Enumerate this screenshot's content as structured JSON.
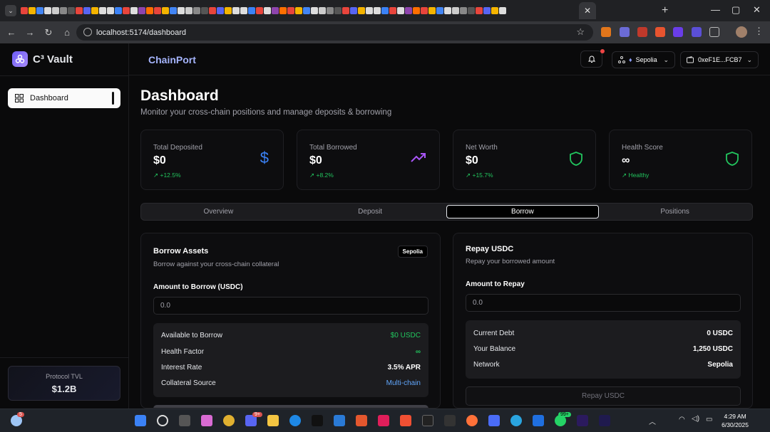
{
  "browser": {
    "url": "localhost:5174/dashboard",
    "new_tab": "+",
    "active_tab_close": "✕"
  },
  "sidebar": {
    "brand": "C³ Vault",
    "items": [
      {
        "label": "Dashboard",
        "icon": "grid-icon"
      }
    ],
    "tvl_label": "Protocol TVL",
    "tvl_value": "$1.2B"
  },
  "header": {
    "title": "ChainPort",
    "network": "Sepolia",
    "wallet": "0xeF1E...FCB7"
  },
  "page": {
    "title": "Dashboard",
    "subtitle": "Monitor your cross-chain positions and manage deposits & borrowing"
  },
  "stats": [
    {
      "label": "Total Deposited",
      "value": "$0",
      "delta": "+12.5%",
      "icon": "dollar-icon",
      "color": "#3b82f6"
    },
    {
      "label": "Total Borrowed",
      "value": "$0",
      "delta": "+8.2%",
      "icon": "trending-up-icon",
      "color": "#a855f7"
    },
    {
      "label": "Net Worth",
      "value": "$0",
      "delta": "+15.7%",
      "icon": "shield-icon",
      "color": "#22c55e"
    },
    {
      "label": "Health Score",
      "value": "∞",
      "delta": "Healthy",
      "icon": "shield-icon",
      "color": "#22c55e"
    }
  ],
  "tabs": [
    {
      "label": "Overview",
      "active": false
    },
    {
      "label": "Deposit",
      "active": false
    },
    {
      "label": "Borrow",
      "active": true
    },
    {
      "label": "Positions",
      "active": false
    }
  ],
  "borrow": {
    "title": "Borrow Assets",
    "badge": "Sepolia",
    "description": "Borrow against your cross-chain collateral",
    "amount_label": "Amount to Borrow (USDC)",
    "amount_placeholder": "0.0",
    "rows": [
      {
        "key": "Available to Borrow",
        "value": "$0 USDC",
        "color": "#22c55e"
      },
      {
        "key": "Health Factor",
        "value": "∞",
        "color": "#22c55e"
      },
      {
        "key": "Interest Rate",
        "value": "3.5% APR",
        "color": "#ffffff"
      },
      {
        "key": "Collateral Source",
        "value": "Multi-chain",
        "color": "#60a5fa"
      }
    ]
  },
  "repay": {
    "title": "Repay USDC",
    "description": "Repay your borrowed amount",
    "amount_label": "Amount to Repay",
    "amount_placeholder": "0.0",
    "rows": [
      {
        "key": "Current Debt",
        "value": "0 USDC"
      },
      {
        "key": "Your Balance",
        "value": "1,250 USDC"
      },
      {
        "key": "Network",
        "value": "Sepolia"
      }
    ],
    "button": "Repay USDC"
  },
  "taskbar": {
    "weather_badge": "5",
    "discord_badge": "9+",
    "whatsapp_badge": "99+",
    "time": "4:29 AM",
    "date": "6/30/2025"
  }
}
